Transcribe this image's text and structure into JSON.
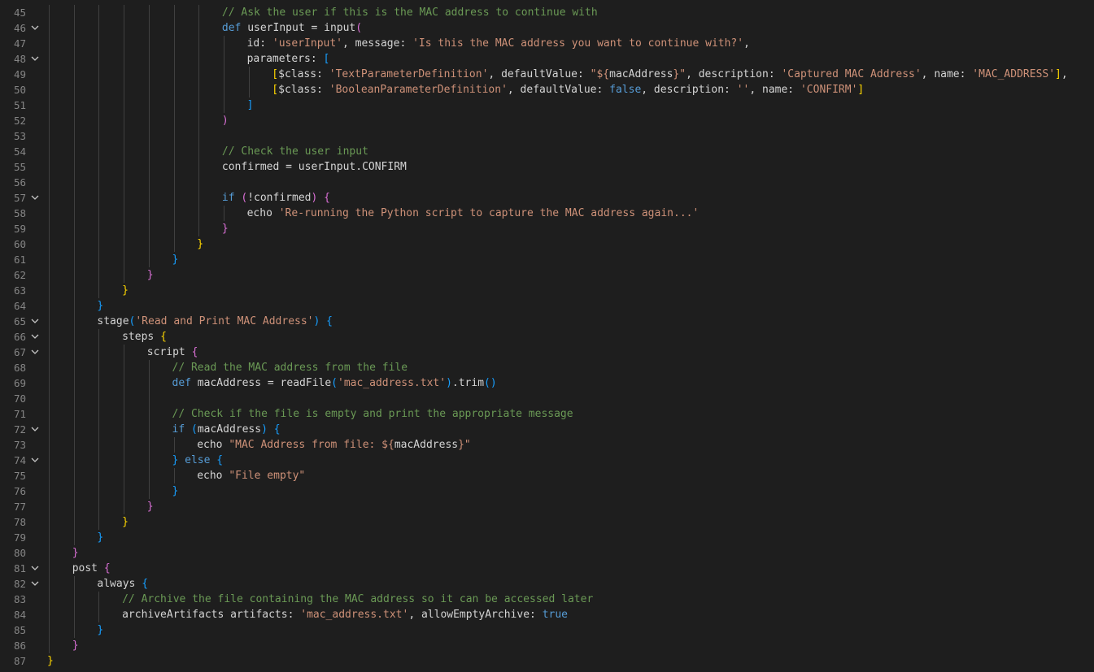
{
  "editor": {
    "lines": [
      {
        "n": "45",
        "fold": false,
        "indent": 7,
        "tokens": [
          [
            "c-cm",
            "// Ask the user if this is the MAC address to continue with"
          ]
        ]
      },
      {
        "n": "46",
        "fold": true,
        "indent": 7,
        "tokens": [
          [
            "c-kw",
            "def"
          ],
          [
            "c-pl",
            " userInput = input"
          ],
          [
            "c-b2",
            "("
          ]
        ]
      },
      {
        "n": "47",
        "fold": false,
        "indent": 8,
        "tokens": [
          [
            "c-pl",
            "id: "
          ],
          [
            "c-str",
            "'userInput'"
          ],
          [
            "c-pl",
            ", message: "
          ],
          [
            "c-str",
            "'Is this the MAC address you want to continue with?'"
          ],
          [
            "c-pl",
            ","
          ]
        ]
      },
      {
        "n": "48",
        "fold": true,
        "indent": 8,
        "tokens": [
          [
            "c-pl",
            "parameters: "
          ],
          [
            "c-b3",
            "["
          ]
        ]
      },
      {
        "n": "49",
        "fold": false,
        "indent": 9,
        "tokens": [
          [
            "c-b1",
            "["
          ],
          [
            "c-pl",
            "$class: "
          ],
          [
            "c-str",
            "'TextParameterDefinition'"
          ],
          [
            "c-pl",
            ", defaultValue: "
          ],
          [
            "c-str",
            "\"${"
          ],
          [
            "c-pl",
            "macAddress"
          ],
          [
            "c-str",
            "}\""
          ],
          [
            "c-pl",
            ", description: "
          ],
          [
            "c-str",
            "'Captured MAC Address'"
          ],
          [
            "c-pl",
            ", name: "
          ],
          [
            "c-str",
            "'MAC_ADDRESS'"
          ],
          [
            "c-b1",
            "]"
          ],
          [
            "c-pl",
            ","
          ]
        ]
      },
      {
        "n": "50",
        "fold": false,
        "indent": 9,
        "tokens": [
          [
            "c-b1",
            "["
          ],
          [
            "c-pl",
            "$class: "
          ],
          [
            "c-str",
            "'BooleanParameterDefinition'"
          ],
          [
            "c-pl",
            ", defaultValue: "
          ],
          [
            "c-kw",
            "false"
          ],
          [
            "c-pl",
            ", description: "
          ],
          [
            "c-str",
            "''"
          ],
          [
            "c-pl",
            ", name: "
          ],
          [
            "c-str",
            "'CONFIRM'"
          ],
          [
            "c-b1",
            "]"
          ]
        ]
      },
      {
        "n": "51",
        "fold": false,
        "indent": 8,
        "tokens": [
          [
            "c-b3",
            "]"
          ]
        ]
      },
      {
        "n": "52",
        "fold": false,
        "indent": 7,
        "tokens": [
          [
            "c-b2",
            ")"
          ]
        ]
      },
      {
        "n": "53",
        "fold": false,
        "indent": 7,
        "tokens": []
      },
      {
        "n": "54",
        "fold": false,
        "indent": 7,
        "tokens": [
          [
            "c-cm",
            "// Check the user input"
          ]
        ]
      },
      {
        "n": "55",
        "fold": false,
        "indent": 7,
        "tokens": [
          [
            "c-pl",
            "confirmed = userInput.CONFIRM"
          ]
        ]
      },
      {
        "n": "56",
        "fold": false,
        "indent": 7,
        "tokens": []
      },
      {
        "n": "57",
        "fold": true,
        "indent": 7,
        "tokens": [
          [
            "c-kw",
            "if"
          ],
          [
            "c-pl",
            " "
          ],
          [
            "c-b2",
            "("
          ],
          [
            "c-pl",
            "!confirmed"
          ],
          [
            "c-b2",
            ")"
          ],
          [
            "c-pl",
            " "
          ],
          [
            "c-b2",
            "{"
          ]
        ]
      },
      {
        "n": "58",
        "fold": false,
        "indent": 8,
        "tokens": [
          [
            "c-pl",
            "echo "
          ],
          [
            "c-str",
            "'Re-running the Python script to capture the MAC address again...'"
          ]
        ]
      },
      {
        "n": "59",
        "fold": false,
        "indent": 7,
        "tokens": [
          [
            "c-b2",
            "}"
          ]
        ]
      },
      {
        "n": "60",
        "fold": false,
        "indent": 6,
        "tokens": [
          [
            "c-b1",
            "}"
          ]
        ]
      },
      {
        "n": "61",
        "fold": false,
        "indent": 5,
        "tokens": [
          [
            "c-b3",
            "}"
          ]
        ]
      },
      {
        "n": "62",
        "fold": false,
        "indent": 4,
        "tokens": [
          [
            "c-b2",
            "}"
          ]
        ]
      },
      {
        "n": "63",
        "fold": false,
        "indent": 3,
        "tokens": [
          [
            "c-b1",
            "}"
          ]
        ]
      },
      {
        "n": "64",
        "fold": false,
        "indent": 2,
        "tokens": [
          [
            "c-b3",
            "}"
          ]
        ]
      },
      {
        "n": "65",
        "fold": true,
        "indent": 2,
        "tokens": [
          [
            "c-pl",
            "stage"
          ],
          [
            "c-b3",
            "("
          ],
          [
            "c-str",
            "'Read and Print MAC Address'"
          ],
          [
            "c-b3",
            ")"
          ],
          [
            "c-pl",
            " "
          ],
          [
            "c-b3",
            "{"
          ]
        ]
      },
      {
        "n": "66",
        "fold": true,
        "indent": 3,
        "tokens": [
          [
            "c-pl",
            "steps "
          ],
          [
            "c-b1",
            "{"
          ]
        ]
      },
      {
        "n": "67",
        "fold": true,
        "indent": 4,
        "tokens": [
          [
            "c-pl",
            "script "
          ],
          [
            "c-b2",
            "{"
          ]
        ]
      },
      {
        "n": "68",
        "fold": false,
        "indent": 5,
        "tokens": [
          [
            "c-cm",
            "// Read the MAC address from the file"
          ]
        ]
      },
      {
        "n": "69",
        "fold": false,
        "indent": 5,
        "tokens": [
          [
            "c-kw",
            "def"
          ],
          [
            "c-pl",
            " macAddress = readFile"
          ],
          [
            "c-b3",
            "("
          ],
          [
            "c-str",
            "'mac_address.txt'"
          ],
          [
            "c-b3",
            ")"
          ],
          [
            "c-pl",
            ".trim"
          ],
          [
            "c-b3",
            "()"
          ]
        ]
      },
      {
        "n": "70",
        "fold": false,
        "indent": 5,
        "tokens": []
      },
      {
        "n": "71",
        "fold": false,
        "indent": 5,
        "tokens": [
          [
            "c-cm",
            "// Check if the file is empty and print the appropriate message"
          ]
        ]
      },
      {
        "n": "72",
        "fold": true,
        "indent": 5,
        "tokens": [
          [
            "c-kw",
            "if"
          ],
          [
            "c-pl",
            " "
          ],
          [
            "c-b3",
            "("
          ],
          [
            "c-pl",
            "macAddress"
          ],
          [
            "c-b3",
            ")"
          ],
          [
            "c-pl",
            " "
          ],
          [
            "c-b3",
            "{"
          ]
        ]
      },
      {
        "n": "73",
        "fold": false,
        "indent": 6,
        "tokens": [
          [
            "c-pl",
            "echo "
          ],
          [
            "c-str",
            "\"MAC Address from file: ${"
          ],
          [
            "c-pl",
            "macAddress"
          ],
          [
            "c-str",
            "}\""
          ]
        ]
      },
      {
        "n": "74",
        "fold": true,
        "indent": 5,
        "tokens": [
          [
            "c-b3",
            "}"
          ],
          [
            "c-pl",
            " "
          ],
          [
            "c-kw",
            "else"
          ],
          [
            "c-pl",
            " "
          ],
          [
            "c-b3",
            "{"
          ]
        ]
      },
      {
        "n": "75",
        "fold": false,
        "indent": 6,
        "tokens": [
          [
            "c-pl",
            "echo "
          ],
          [
            "c-str",
            "\"File empty\""
          ]
        ]
      },
      {
        "n": "76",
        "fold": false,
        "indent": 5,
        "tokens": [
          [
            "c-b3",
            "}"
          ]
        ]
      },
      {
        "n": "77",
        "fold": false,
        "indent": 4,
        "tokens": [
          [
            "c-b2",
            "}"
          ]
        ]
      },
      {
        "n": "78",
        "fold": false,
        "indent": 3,
        "tokens": [
          [
            "c-b1",
            "}"
          ]
        ]
      },
      {
        "n": "79",
        "fold": false,
        "indent": 2,
        "tokens": [
          [
            "c-b3",
            "}"
          ]
        ]
      },
      {
        "n": "80",
        "fold": false,
        "indent": 1,
        "tokens": [
          [
            "c-b2",
            "}"
          ]
        ]
      },
      {
        "n": "81",
        "fold": true,
        "indent": 1,
        "tokens": [
          [
            "c-pl",
            "post "
          ],
          [
            "c-b2",
            "{"
          ]
        ]
      },
      {
        "n": "82",
        "fold": true,
        "indent": 2,
        "tokens": [
          [
            "c-pl",
            "always "
          ],
          [
            "c-b3",
            "{"
          ]
        ]
      },
      {
        "n": "83",
        "fold": false,
        "indent": 3,
        "tokens": [
          [
            "c-cm",
            "// Archive the file containing the MAC address so it can be accessed later"
          ]
        ]
      },
      {
        "n": "84",
        "fold": false,
        "indent": 3,
        "tokens": [
          [
            "c-pl",
            "archiveArtifacts artifacts: "
          ],
          [
            "c-str",
            "'mac_address.txt'"
          ],
          [
            "c-pl",
            ", allowEmptyArchive: "
          ],
          [
            "c-kw",
            "true"
          ]
        ]
      },
      {
        "n": "85",
        "fold": false,
        "indent": 2,
        "tokens": [
          [
            "c-b3",
            "}"
          ]
        ]
      },
      {
        "n": "86",
        "fold": false,
        "indent": 1,
        "tokens": [
          [
            "c-b2",
            "}"
          ]
        ]
      },
      {
        "n": "87",
        "fold": false,
        "indent": 0,
        "tokens": [
          [
            "c-b1",
            "}"
          ]
        ]
      }
    ]
  }
}
